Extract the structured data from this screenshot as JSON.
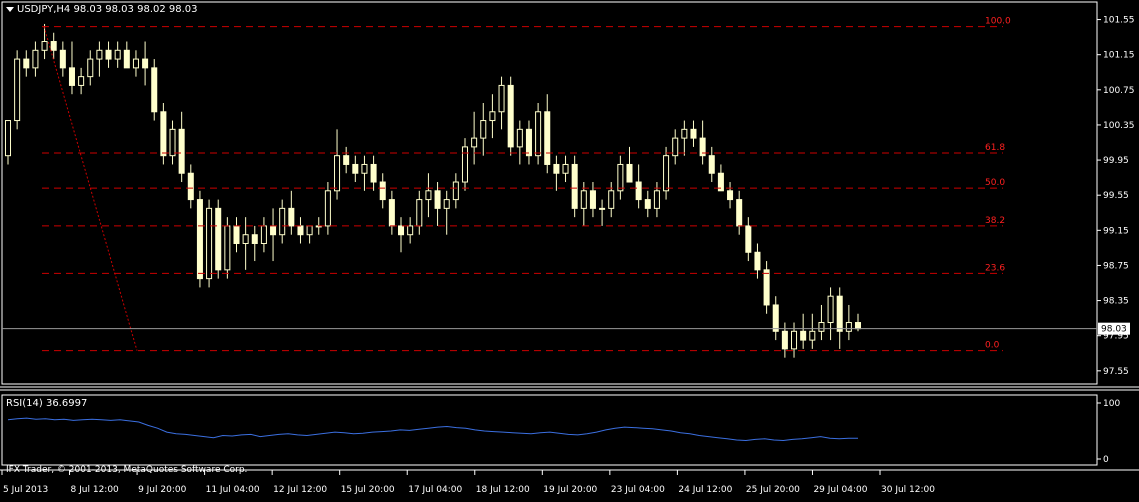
{
  "symbol_title": "USDJPY,H4  98.03 98.03 98.02 98.03",
  "rsi_title": "RSI(14) 36.6997",
  "copyright": "IFX Trader, © 2001-2013, MetaQuotes Software Corp.",
  "colors": {
    "background": "#000000",
    "candle": "#ffffcc",
    "fib_line": "#cc0000",
    "fib_label": "#ff2020",
    "rsi_line": "#3b6fe0",
    "axis_text": "#ffffff",
    "price_line": "#9a9a9a"
  },
  "chart_data": [
    {
      "type": "candlestick",
      "title": "USDJPY,H4",
      "ylim": [
        97.4,
        101.75
      ],
      "y_ticks": [
        "101.55",
        "101.15",
        "100.75",
        "100.35",
        "99.95",
        "99.55",
        "99.15",
        "98.75",
        "98.35",
        "97.95",
        "97.55"
      ],
      "x_ticks": [
        "5 Jul 2013",
        "8 Jul 12:00",
        "9 Jul 20:00",
        "11 Jul 04:00",
        "12 Jul 12:00",
        "15 Jul 20:00",
        "17 Jul 04:00",
        "18 Jul 12:00",
        "19 Jul 20:00",
        "23 Jul 04:00",
        "24 Jul 12:00",
        "25 Jul 20:00",
        "29 Jul 04:00",
        "30 Jul 12:00"
      ],
      "current_price": "98.03",
      "fibonacci": {
        "levels": [
          {
            "label": "100.0",
            "price": 101.47
          },
          {
            "label": "61.8",
            "price": 100.03
          },
          {
            "label": "50.0",
            "price": 99.63
          },
          {
            "label": "38.2",
            "price": 99.2
          },
          {
            "label": "23.6",
            "price": 98.66
          },
          {
            "label": "0.0",
            "price": 97.78
          }
        ],
        "trend_from": 101.47,
        "trend_to": 97.78
      },
      "candles": [
        [
          100.0,
          100.4,
          99.9,
          100.4
        ],
        [
          100.4,
          101.2,
          100.3,
          101.1
        ],
        [
          101.1,
          101.2,
          100.9,
          101.0
        ],
        [
          101.0,
          101.3,
          100.9,
          101.2
        ],
        [
          101.2,
          101.5,
          101.1,
          101.3
        ],
        [
          101.3,
          101.4,
          101.1,
          101.2
        ],
        [
          101.2,
          101.3,
          100.9,
          101.0
        ],
        [
          101.0,
          101.3,
          100.7,
          100.8
        ],
        [
          100.8,
          101.0,
          100.7,
          100.9
        ],
        [
          100.9,
          101.2,
          100.8,
          101.1
        ],
        [
          101.1,
          101.3,
          100.9,
          101.2
        ],
        [
          101.2,
          101.3,
          101.0,
          101.1
        ],
        [
          101.1,
          101.3,
          101.0,
          101.2
        ],
        [
          101.2,
          101.3,
          101.0,
          101.0
        ],
        [
          101.0,
          101.2,
          100.9,
          101.1
        ],
        [
          101.1,
          101.3,
          100.8,
          101.0
        ],
        [
          101.0,
          101.1,
          100.4,
          100.5
        ],
        [
          100.5,
          100.6,
          99.9,
          100.0
        ],
        [
          100.0,
          100.4,
          99.9,
          100.3
        ],
        [
          100.3,
          100.5,
          99.7,
          99.8
        ],
        [
          99.8,
          99.9,
          99.4,
          99.5
        ],
        [
          99.5,
          99.6,
          98.5,
          98.6
        ],
        [
          98.6,
          99.5,
          98.5,
          99.4
        ],
        [
          99.4,
          99.5,
          98.6,
          98.7
        ],
        [
          98.7,
          99.3,
          98.6,
          99.2
        ],
        [
          99.2,
          99.3,
          98.9,
          99.0
        ],
        [
          99.0,
          99.3,
          98.7,
          99.1
        ],
        [
          99.1,
          99.2,
          98.8,
          99.0
        ],
        [
          99.0,
          99.3,
          98.9,
          99.2
        ],
        [
          99.2,
          99.4,
          98.8,
          99.1
        ],
        [
          99.1,
          99.5,
          99.0,
          99.4
        ],
        [
          99.4,
          99.6,
          99.1,
          99.2
        ],
        [
          99.2,
          99.3,
          99.0,
          99.1
        ],
        [
          99.1,
          99.2,
          99.0,
          99.2
        ],
        [
          99.2,
          99.3,
          99.1,
          99.2
        ],
        [
          99.2,
          99.7,
          99.1,
          99.6
        ],
        [
          99.6,
          100.3,
          99.5,
          100.0
        ],
        [
          100.0,
          100.1,
          99.8,
          99.9
        ],
        [
          99.9,
          100.0,
          99.7,
          99.8
        ],
        [
          99.8,
          100.0,
          99.6,
          99.9
        ],
        [
          99.9,
          100.0,
          99.6,
          99.7
        ],
        [
          99.7,
          99.8,
          99.4,
          99.5
        ],
        [
          99.5,
          99.6,
          99.1,
          99.2
        ],
        [
          99.2,
          99.3,
          98.9,
          99.1
        ],
        [
          99.1,
          99.3,
          99.0,
          99.2
        ],
        [
          99.2,
          99.6,
          99.1,
          99.5
        ],
        [
          99.5,
          99.8,
          99.3,
          99.6
        ],
        [
          99.6,
          99.7,
          99.2,
          99.4
        ],
        [
          99.4,
          99.6,
          99.1,
          99.5
        ],
        [
          99.5,
          99.8,
          99.4,
          99.7
        ],
        [
          99.7,
          100.2,
          99.6,
          100.1
        ],
        [
          100.1,
          100.5,
          99.9,
          100.2
        ],
        [
          100.2,
          100.6,
          100.0,
          100.4
        ],
        [
          100.4,
          100.7,
          100.2,
          100.5
        ],
        [
          100.5,
          100.9,
          100.3,
          100.8
        ],
        [
          100.8,
          100.9,
          100.0,
          100.1
        ],
        [
          100.1,
          100.4,
          99.9,
          100.3
        ],
        [
          100.3,
          100.4,
          99.9,
          100.0
        ],
        [
          100.0,
          100.6,
          99.9,
          100.5
        ],
        [
          100.5,
          100.7,
          99.8,
          99.9
        ],
        [
          99.9,
          100.0,
          99.6,
          99.8
        ],
        [
          99.8,
          100.0,
          99.7,
          99.9
        ],
        [
          99.9,
          100.0,
          99.3,
          99.4
        ],
        [
          99.4,
          99.7,
          99.2,
          99.6
        ],
        [
          99.6,
          99.7,
          99.3,
          99.4
        ],
        [
          99.4,
          99.5,
          99.2,
          99.4
        ],
        [
          99.4,
          99.7,
          99.3,
          99.6
        ],
        [
          99.6,
          100.0,
          99.5,
          99.9
        ],
        [
          99.9,
          100.1,
          99.7,
          99.7
        ],
        [
          99.7,
          99.9,
          99.4,
          99.5
        ],
        [
          99.5,
          99.6,
          99.3,
          99.4
        ],
        [
          99.4,
          99.7,
          99.3,
          99.6
        ],
        [
          99.6,
          100.1,
          99.5,
          100.0
        ],
        [
          100.0,
          100.3,
          99.9,
          100.2
        ],
        [
          100.2,
          100.4,
          100.0,
          100.3
        ],
        [
          100.3,
          100.4,
          100.1,
          100.2
        ],
        [
          100.2,
          100.4,
          99.9,
          100.0
        ],
        [
          100.0,
          100.1,
          99.7,
          99.8
        ],
        [
          99.8,
          99.9,
          99.6,
          99.6
        ],
        [
          99.6,
          99.7,
          99.4,
          99.5
        ],
        [
          99.5,
          99.6,
          99.1,
          99.2
        ],
        [
          99.2,
          99.3,
          98.8,
          98.9
        ],
        [
          98.9,
          99.0,
          98.6,
          98.7
        ],
        [
          98.7,
          98.8,
          98.2,
          98.3
        ],
        [
          98.3,
          98.4,
          97.9,
          98.0
        ],
        [
          98.0,
          98.1,
          97.7,
          97.8
        ],
        [
          97.8,
          98.1,
          97.7,
          98.0
        ],
        [
          98.0,
          98.2,
          97.8,
          97.9
        ],
        [
          97.9,
          98.2,
          97.8,
          98.0
        ],
        [
          98.0,
          98.3,
          97.9,
          98.1
        ],
        [
          98.1,
          98.5,
          97.9,
          98.4
        ],
        [
          98.4,
          98.5,
          97.8,
          98.0
        ],
        [
          98.0,
          98.3,
          97.9,
          98.1
        ],
        [
          98.1,
          98.2,
          98.0,
          98.03
        ]
      ]
    },
    {
      "type": "line",
      "title": "RSI(14)",
      "ylim": [
        0,
        100
      ],
      "y_ticks": [
        "100",
        "0"
      ],
      "values": [
        70,
        72,
        73,
        71,
        72,
        70,
        71,
        69,
        70,
        71,
        70,
        69,
        70,
        68,
        66,
        60,
        55,
        48,
        45,
        44,
        42,
        40,
        38,
        42,
        41,
        43,
        44,
        40,
        42,
        44,
        45,
        43,
        42,
        44,
        46,
        48,
        47,
        45,
        46,
        48,
        49,
        50,
        52,
        51,
        53,
        55,
        57,
        58,
        56,
        55,
        52,
        50,
        49,
        48,
        47,
        46,
        45,
        47,
        48,
        46,
        44,
        43,
        45,
        48,
        52,
        55,
        57,
        56,
        55,
        54,
        52,
        50,
        47,
        45,
        42,
        40,
        38,
        36,
        34,
        33,
        35,
        36,
        34,
        33,
        35,
        36,
        38,
        40,
        37,
        36,
        37,
        37
      ]
    }
  ]
}
